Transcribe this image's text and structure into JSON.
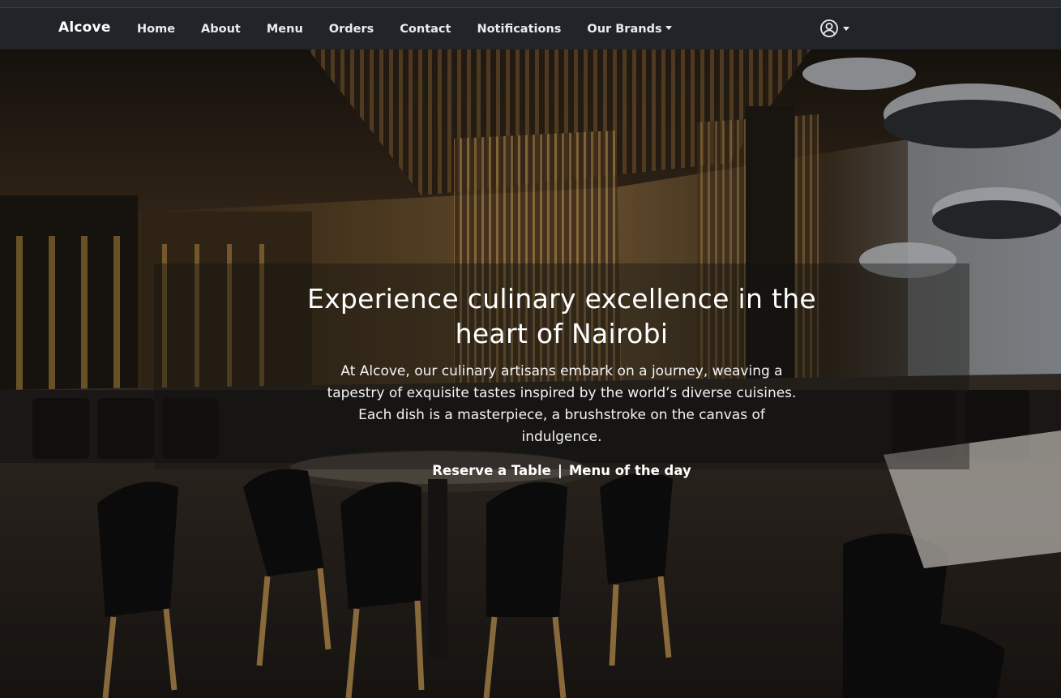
{
  "nav": {
    "brand": "Alcove",
    "links": [
      "Home",
      "About",
      "Menu",
      "Orders",
      "Contact",
      "Notifications"
    ],
    "dropdown": "Our Brands",
    "account_icon": "user-circle-icon"
  },
  "hero": {
    "title": "Experience culinary excellence in the heart of Nairobi",
    "description": "At Alcove, our culinary artisans embark on a journey, weaving a tapestry of exquisite tastes inspired by the world’s diverse cuisines. Each dish is a masterpiece, a brushstroke on the canvas of indulgence.",
    "cta_reserve": "Reserve a Table",
    "separator": "|",
    "cta_menu": "Menu of the day"
  },
  "colors": {
    "navbar": "#212529",
    "text": "#ffffff",
    "caption_overlay": "rgba(20,18,16,0.42)"
  }
}
